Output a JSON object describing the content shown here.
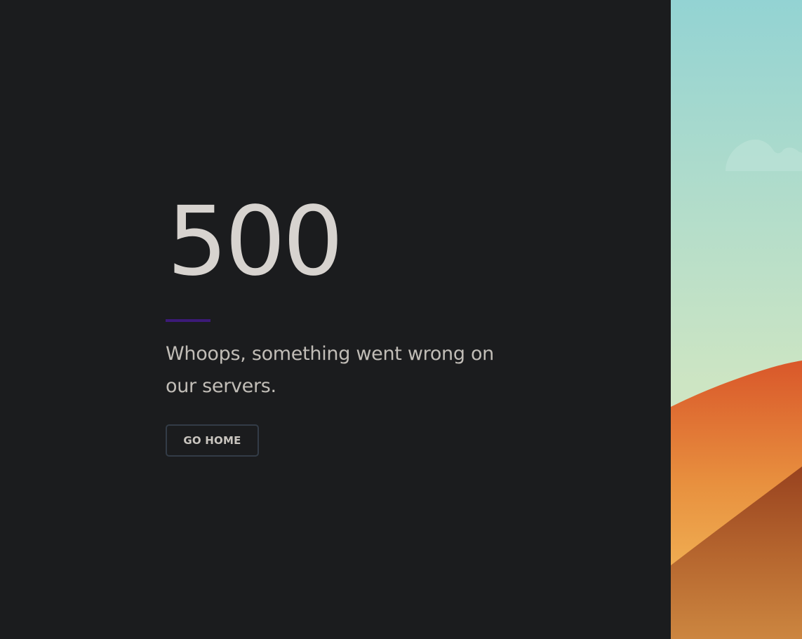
{
  "error": {
    "code": "500",
    "message": "Whoops, something went wrong on our servers.",
    "button_label": "GO HOME"
  },
  "colors": {
    "background": "#1b1c1e",
    "code_text": "#d7d3cf",
    "accent_divider": "#3c1a78",
    "message_text": "#c1bdb7",
    "button_border": "#333c47",
    "sky_top": "#93d3d3",
    "sky_bottom": "#cde5c3",
    "dune_orange": "#d9602a",
    "dune_light": "#f2b45a",
    "dune_shadow": "#a24a22"
  },
  "illustration": {
    "icon": "desert-landscape-illustration"
  }
}
